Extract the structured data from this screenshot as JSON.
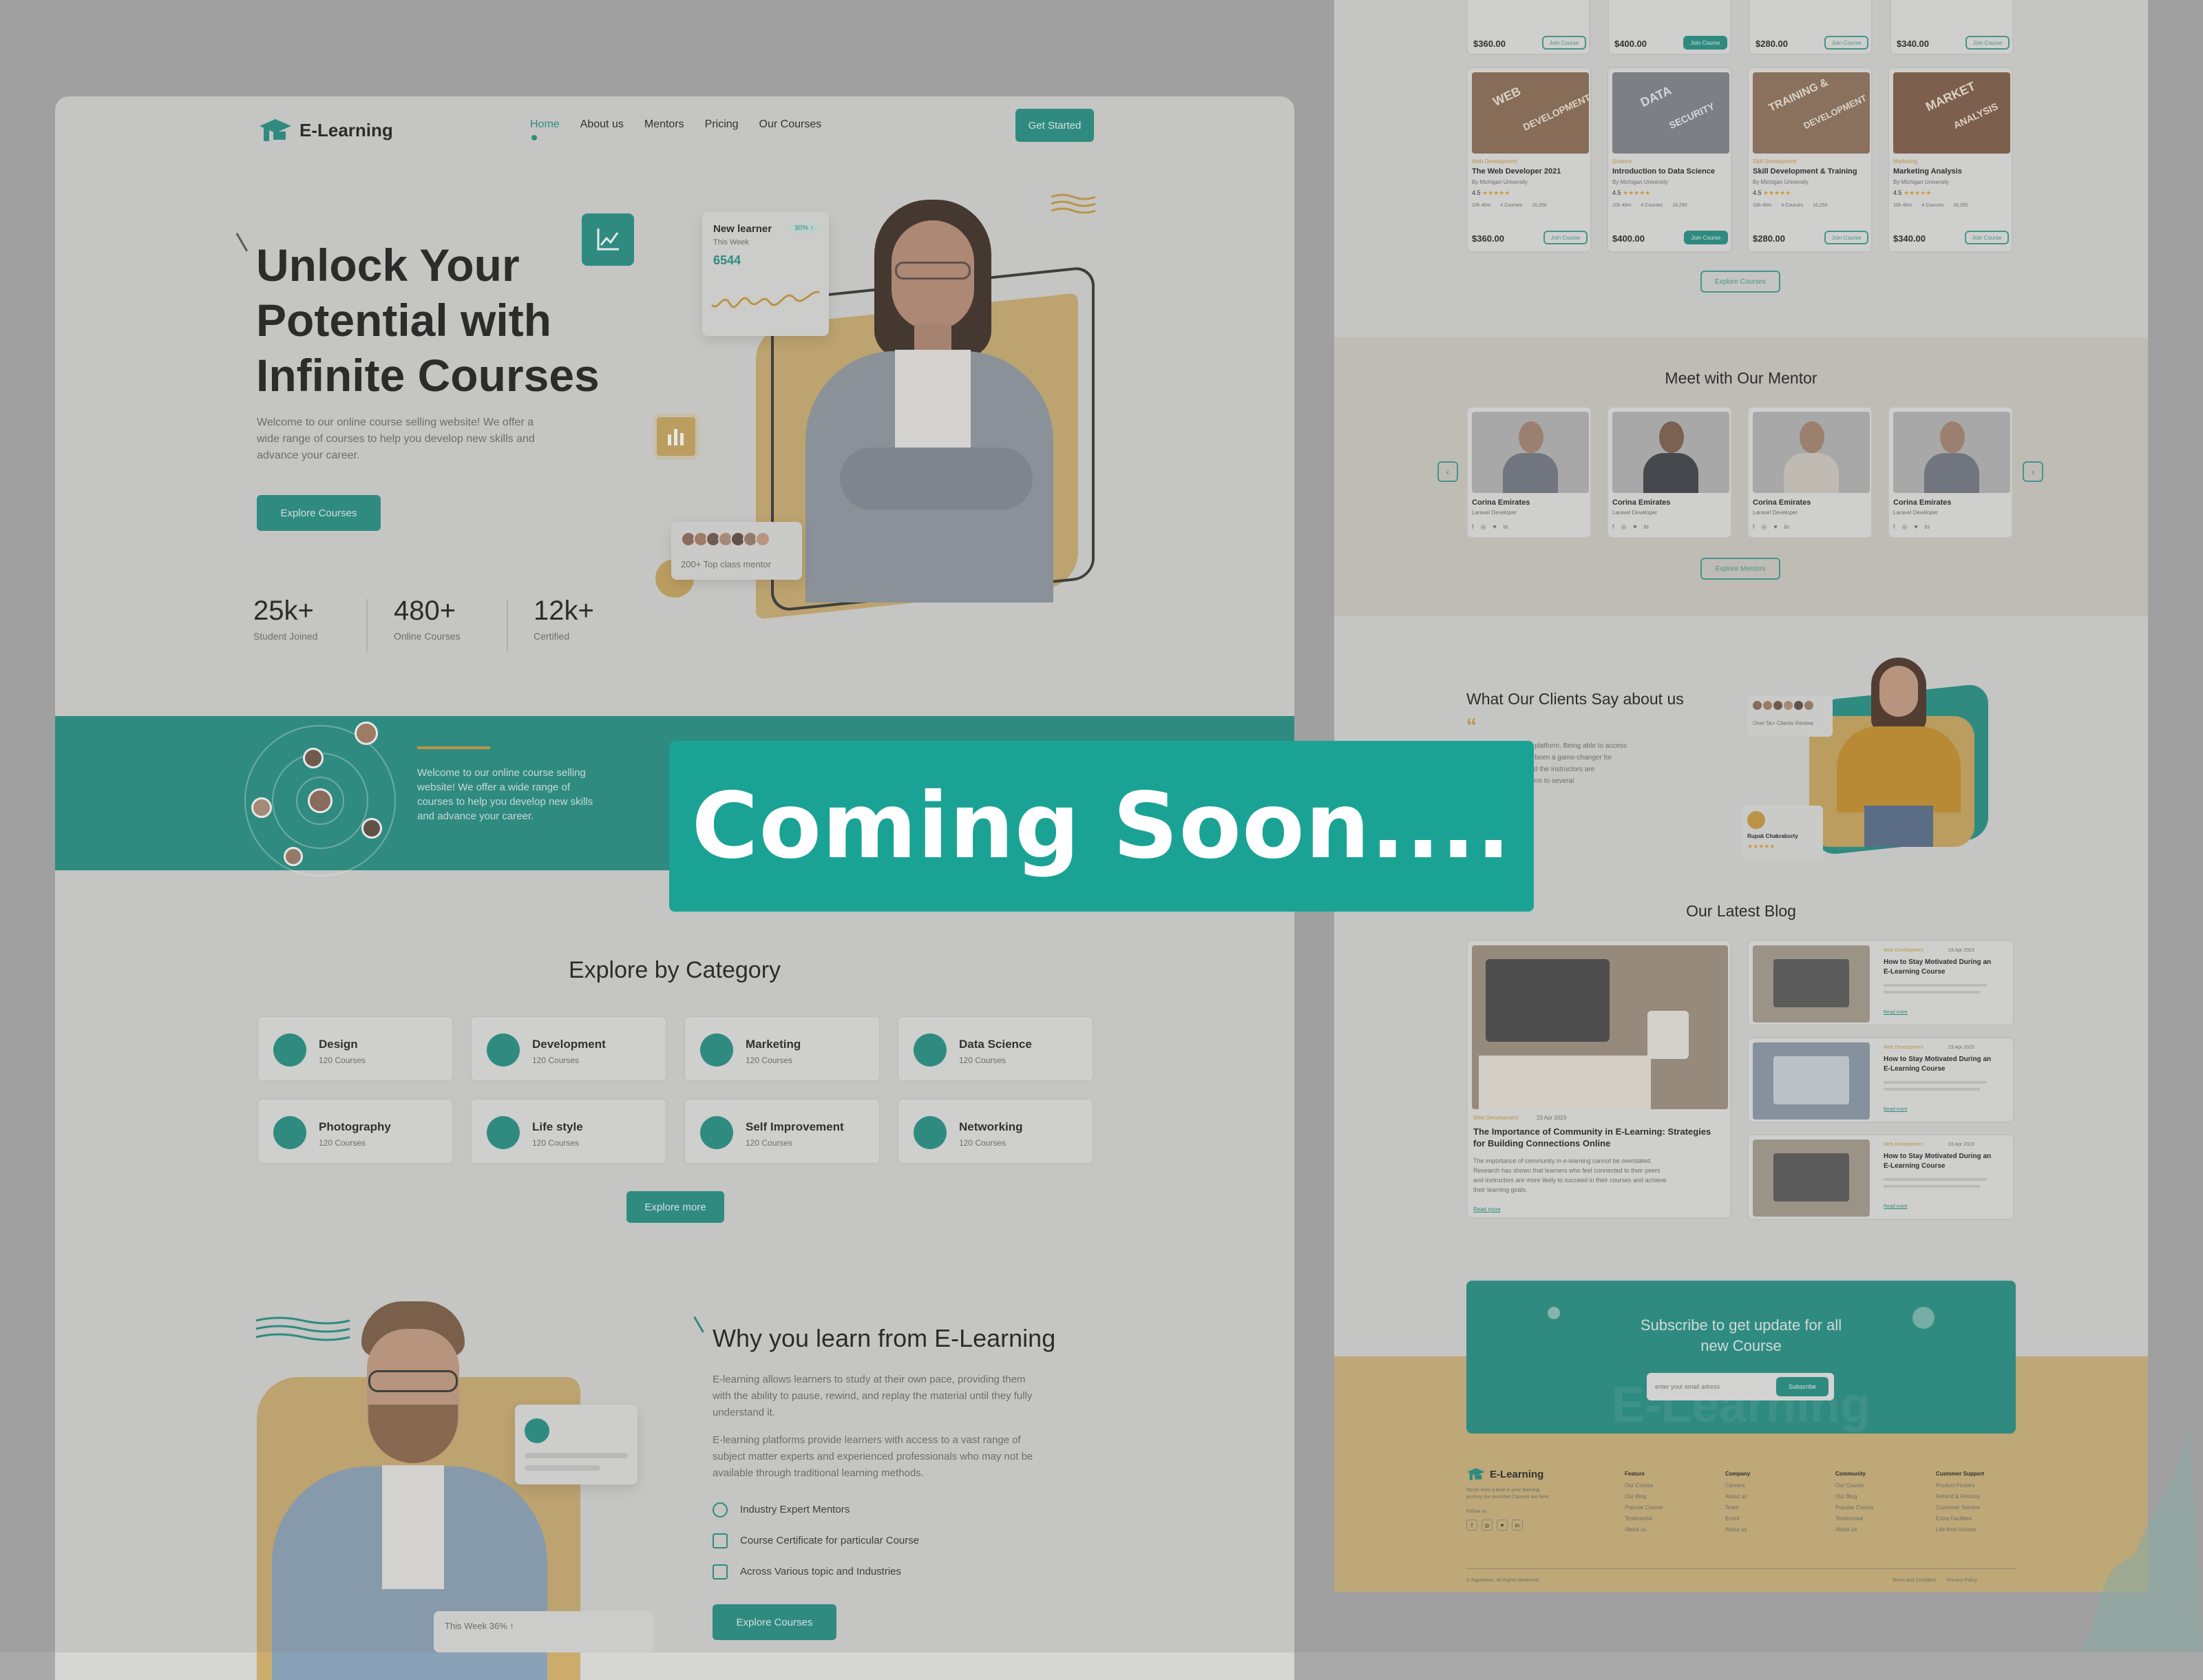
{
  "brand": {
    "name": "E-Learning",
    "teal": "#1f8f82",
    "gold": "#d9a431"
  },
  "nav": {
    "items": [
      "Home",
      "About us",
      "Mentors",
      "Pricing",
      "Our Courses"
    ],
    "cta": "Get Started"
  },
  "hero": {
    "title_lines": [
      "Unlock Your",
      "Potential with",
      "Infinite Courses"
    ],
    "subtitle_lines": [
      "Welcome to our online course selling website! We offer a",
      "wide range of courses to help you develop new skills and",
      "advance your career."
    ],
    "cta": "Explore Courses",
    "new_learner": {
      "label": "New learner",
      "period": "This Week",
      "value": "6544",
      "badge": "30% ↑"
    },
    "mentor_badge": "200+ Top class mentor"
  },
  "stats": [
    {
      "value": "25k+",
      "label": "Student Joined"
    },
    {
      "value": "480+",
      "label": "Online Courses"
    },
    {
      "value": "12k+",
      "label": "Certified"
    }
  ],
  "band": {
    "text_lines": [
      "Welcome to our online course selling",
      "website! We offer a wide range of",
      "courses to help you develop new skills",
      "and advance your career."
    ]
  },
  "overlay_text": "Coming Soon....",
  "categories": {
    "title": "Explore by Category",
    "items": [
      {
        "name": "Design",
        "count": "120 Courses"
      },
      {
        "name": "Development",
        "count": "120 Courses"
      },
      {
        "name": "Marketing",
        "count": "120 Courses"
      },
      {
        "name": "Data Science",
        "count": "120 Courses"
      },
      {
        "name": "Photography",
        "count": "120 Courses"
      },
      {
        "name": "Life style",
        "count": "120 Courses"
      },
      {
        "name": "Self Improvement",
        "count": "120 Courses"
      },
      {
        "name": "Networking",
        "count": "120 Courses"
      }
    ],
    "cta": "Explore more"
  },
  "why": {
    "title": "Why you learn from E-Learning",
    "p1_lines": [
      "E-learning allows learners to study at their own pace, providing them",
      "with the ability to pause, rewind, and replay the material until they fully",
      "understand it."
    ],
    "p2_lines": [
      "E-learning platforms provide learners with access to a vast range of",
      "subject matter experts and experienced professionals who may not be",
      "available through traditional learning methods."
    ],
    "features": [
      "Industry Expert Mentors",
      "Course Certificate for particular Course",
      "Across Various topic and Industries"
    ],
    "cta": "Explore Courses",
    "week_badge": "This Week 36% ↑"
  },
  "courses": {
    "top_prices": [
      "$360.00",
      "$400.00",
      "$280.00",
      "$340.00"
    ],
    "items": [
      {
        "tag": "Web Development",
        "title": "The Web Developer 2021",
        "by": "By Michigan University",
        "rating": "4.5",
        "price": "$360.00",
        "img_words": [
          "WEB",
          "DEVELOPMENT"
        ]
      },
      {
        "tag": "Science",
        "title": "Introduction to Data Science",
        "by": "By Michigan University",
        "rating": "4.5",
        "price": "$400.00",
        "img_words": [
          "DATA",
          "SECURITY"
        ]
      },
      {
        "tag": "Skill Development",
        "title": "Skill Development & Training",
        "by": "By Michigan University",
        "rating": "4.5",
        "price": "$280.00",
        "img_words": [
          "TRAINING &",
          "DEVELOPMENT"
        ]
      },
      {
        "tag": "Marketing",
        "title": "Marketing Analysis",
        "by": "By Michigan University",
        "rating": "4.5",
        "price": "$340.00",
        "img_words": [
          "MARKET",
          "ANALYSIS"
        ]
      }
    ],
    "meta": [
      "10h 40m",
      "4 Courses",
      "16,250"
    ],
    "join": "Join Course",
    "cta": "Explore Courses"
  },
  "mentors": {
    "title": "Meet with Our Mentor",
    "items": [
      {
        "name": "Corina Emirates",
        "role": "Laravel Developer"
      },
      {
        "name": "Corina Emirates",
        "role": "Laravel Developer"
      },
      {
        "name": "Corina Emirates",
        "role": "Laravel Developer"
      },
      {
        "name": "Corina Emirates",
        "role": "Laravel Developer"
      }
    ],
    "social": [
      "f",
      "◎",
      "♥",
      "in"
    ],
    "cta": "Explore Mentors"
  },
  "testimonial": {
    "title": "What Our Clients Say about us",
    "quote_lines": [
      "I found this e-learning platform. Being able to access",
      "my own schedule has been a game-changer for",
      "quality is excellent, and the instructors are",
      "recommend this platform to several"
    ],
    "reviews_badge": "Over 5k+ Clients Review",
    "author": "Rupak Chakraborty"
  },
  "blog": {
    "title": "Our Latest Blog",
    "main": {
      "tag": "Web Development",
      "date": "23 Apr 2023",
      "title_lines": [
        "The Importance of Community in E-Learning: Strategies",
        "for Building Connections Online"
      ],
      "excerpt_lines": [
        "The importance of community in e-learning cannot be overstated.",
        "Research has shown that learners who feel connected to their peers",
        "and instructors are more likely to succeed in their courses and achieve",
        "their learning goals."
      ],
      "read": "Read more"
    },
    "side": [
      {
        "tag": "Web Development",
        "date": "23 Apr 2023",
        "title_lines": [
          "How to Stay Motivated During an",
          "E-Learning Course"
        ],
        "read": "Read more"
      },
      {
        "tag": "Web Development",
        "date": "23 Apr 2023",
        "title_lines": [
          "How to Stay Motivated During an",
          "E-Learning Course"
        ],
        "read": "Read more"
      },
      {
        "tag": "Web Development",
        "date": "23 Apr 2023",
        "title_lines": [
          "How to Stay Motivated During an",
          "E-Learning Course"
        ],
        "read": "Read more"
      }
    ]
  },
  "subscribe": {
    "title_lines": [
      "Subscribe to get update for all",
      "new Course"
    ],
    "placeholder": "enter your email adress",
    "button": "Subscribe",
    "watermark": "E-Learning"
  },
  "footer": {
    "about_lines": [
      "Never miss a beat in your learning",
      "journey our recorded Classes are here."
    ],
    "follow": "Follow us",
    "columns": [
      {
        "title": "Feature",
        "links": [
          "Our Course",
          "Our Blog",
          "Popular Course",
          "Testimonial",
          "About us"
        ]
      },
      {
        "title": "Company",
        "links": [
          "Careers",
          "About us",
          "Team",
          "Event",
          "About us"
        ]
      },
      {
        "title": "Community",
        "links": [
          "Our Course",
          "Our Blog",
          "Popular Course",
          "Testimonial",
          "About us"
        ]
      },
      {
        "title": "Customer Support",
        "links": [
          "Product Finders",
          "Refund & Returns",
          "Customer Service",
          "Extra Facilities",
          "Life-time Access"
        ]
      }
    ],
    "copyright": "© Algoritmos. All Rights Reserved.",
    "legal": [
      "Terms and Condition",
      "Privacy Policy"
    ]
  }
}
